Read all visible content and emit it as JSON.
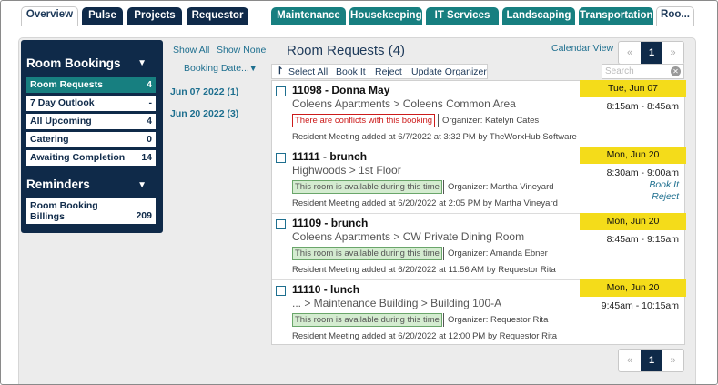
{
  "tabs": [
    {
      "label": "Overview"
    },
    {
      "label": "Pulse"
    },
    {
      "label": "Projects"
    },
    {
      "label": "Requestor"
    },
    {
      "label": "Maintenance"
    },
    {
      "label": "Housekeeping"
    },
    {
      "label": "IT Services"
    },
    {
      "label": "Landscaping"
    },
    {
      "label": "Transportation"
    },
    {
      "label": "Roo..."
    }
  ],
  "sidebar": {
    "title": "Room Bookings",
    "items": [
      {
        "label": "Room Requests",
        "count": "4"
      },
      {
        "label": "7 Day Outlook",
        "count": "-"
      },
      {
        "label": "All Upcoming",
        "count": "4"
      },
      {
        "label": "Catering",
        "count": "0"
      },
      {
        "label": "Awaiting Completion",
        "count": "14"
      }
    ],
    "reminders_title": "Reminders",
    "reminders": [
      {
        "label": "Room Booking Billings",
        "count": "209"
      }
    ]
  },
  "datecol": {
    "show_all": "Show All",
    "show_none": "Show None",
    "sort_label": "Booking Date...",
    "dates": [
      {
        "label": "Jun 07 2022 (1)"
      },
      {
        "label": "Jun 20 2022 (3)"
      }
    ]
  },
  "main": {
    "title": "Room Requests (4)",
    "calendar_view": "Calendar View",
    "toolbar": {
      "select_all": "Select All",
      "book_it": "Book It",
      "reject": "Reject",
      "update_organizer": "Update Organizer"
    },
    "search_placeholder": "Search",
    "page": "1",
    "prev": "«",
    "next": "»"
  },
  "requests": [
    {
      "title": "11098 - Donna May",
      "location": "Coleens Apartments > Coleens Common Area",
      "status": "There are conflicts with this booking",
      "organizer": "Organizer: Katelyn Cates",
      "added": "Resident Meeting added at 6/7/2022 at 3:32 PM by TheWorxHub Software",
      "date": "Tue, Jun 07",
      "time": "8:15am - 8:45am"
    },
    {
      "title": "11111 - brunch",
      "location": "Highwoods > 1st Floor",
      "status": "This room is available during this time",
      "organizer": "Organizer: Martha Vineyard",
      "added": "Resident Meeting added at 6/20/2022 at 2:05 PM by Martha Vineyard",
      "date": "Mon, Jun 20",
      "time": "8:30am - 9:00am",
      "book_it": "Book It",
      "reject": "Reject"
    },
    {
      "title": "11109 - brunch",
      "location": "Coleens Apartments > CW Private Dining Room",
      "status": "This room is available during this time",
      "organizer": "Organizer: Amanda Ebner",
      "added": "Resident Meeting added at 6/20/2022 at 11:56 AM by Requestor Rita",
      "date": "Mon, Jun 20",
      "time": "8:45am - 9:15am"
    },
    {
      "title": "11110 - lunch",
      "location": "... > Maintenance Building > Building 100-A",
      "status": "This room is available during this time",
      "organizer": "Organizer: Requestor Rita",
      "added": "Resident Meeting added at 6/20/2022 at 12:00 PM by Requestor Rita",
      "date": "Mon, Jun 20",
      "time": "9:45am - 10:15am"
    }
  ],
  "colors": {
    "navy": "#0f2a49",
    "teal": "#177f80",
    "date_badge": "#f4dc1a",
    "conflict": "#cc1b1b",
    "available": "#d4ecd0"
  }
}
